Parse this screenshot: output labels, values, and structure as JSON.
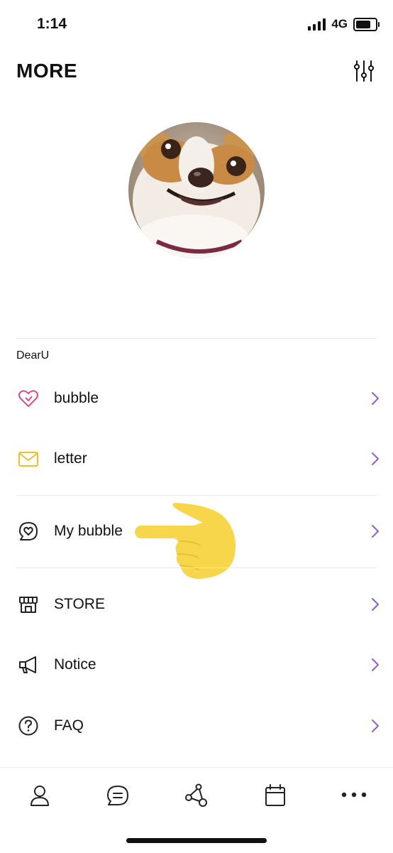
{
  "status_bar": {
    "time": "1:14",
    "network": "4G",
    "battery_level": 0.85
  },
  "header": {
    "title": "MORE",
    "settings_icon": "sliders-icon"
  },
  "profile": {
    "avatar_icon": "profile-photo-dog"
  },
  "section": {
    "label": "DearU"
  },
  "menu": {
    "bubble": {
      "label": "bubble",
      "icon": "heart-icon",
      "color": "#d8507f"
    },
    "letter": {
      "label": "letter",
      "icon": "envelope-icon",
      "color": "#e8c12c"
    },
    "my_bubble": {
      "label": "My bubble",
      "icon": "chat-heart-icon",
      "color": "#222222"
    },
    "store": {
      "label": "STORE",
      "icon": "store-icon",
      "color": "#222222"
    },
    "notice": {
      "label": "Notice",
      "icon": "megaphone-icon",
      "color": "#222222"
    },
    "faq": {
      "label": "FAQ",
      "icon": "question-icon",
      "color": "#222222"
    }
  },
  "chevron_color": "#8b5fd6",
  "annotation": {
    "icon": "pointing-hand-emoji",
    "color": "#f7d64c"
  },
  "tabs": [
    {
      "name": "profile",
      "icon": "person-icon"
    },
    {
      "name": "chat",
      "icon": "chat-icon"
    },
    {
      "name": "connections",
      "icon": "network-icon"
    },
    {
      "name": "calendar",
      "icon": "calendar-icon"
    },
    {
      "name": "more",
      "icon": "more-icon"
    }
  ]
}
